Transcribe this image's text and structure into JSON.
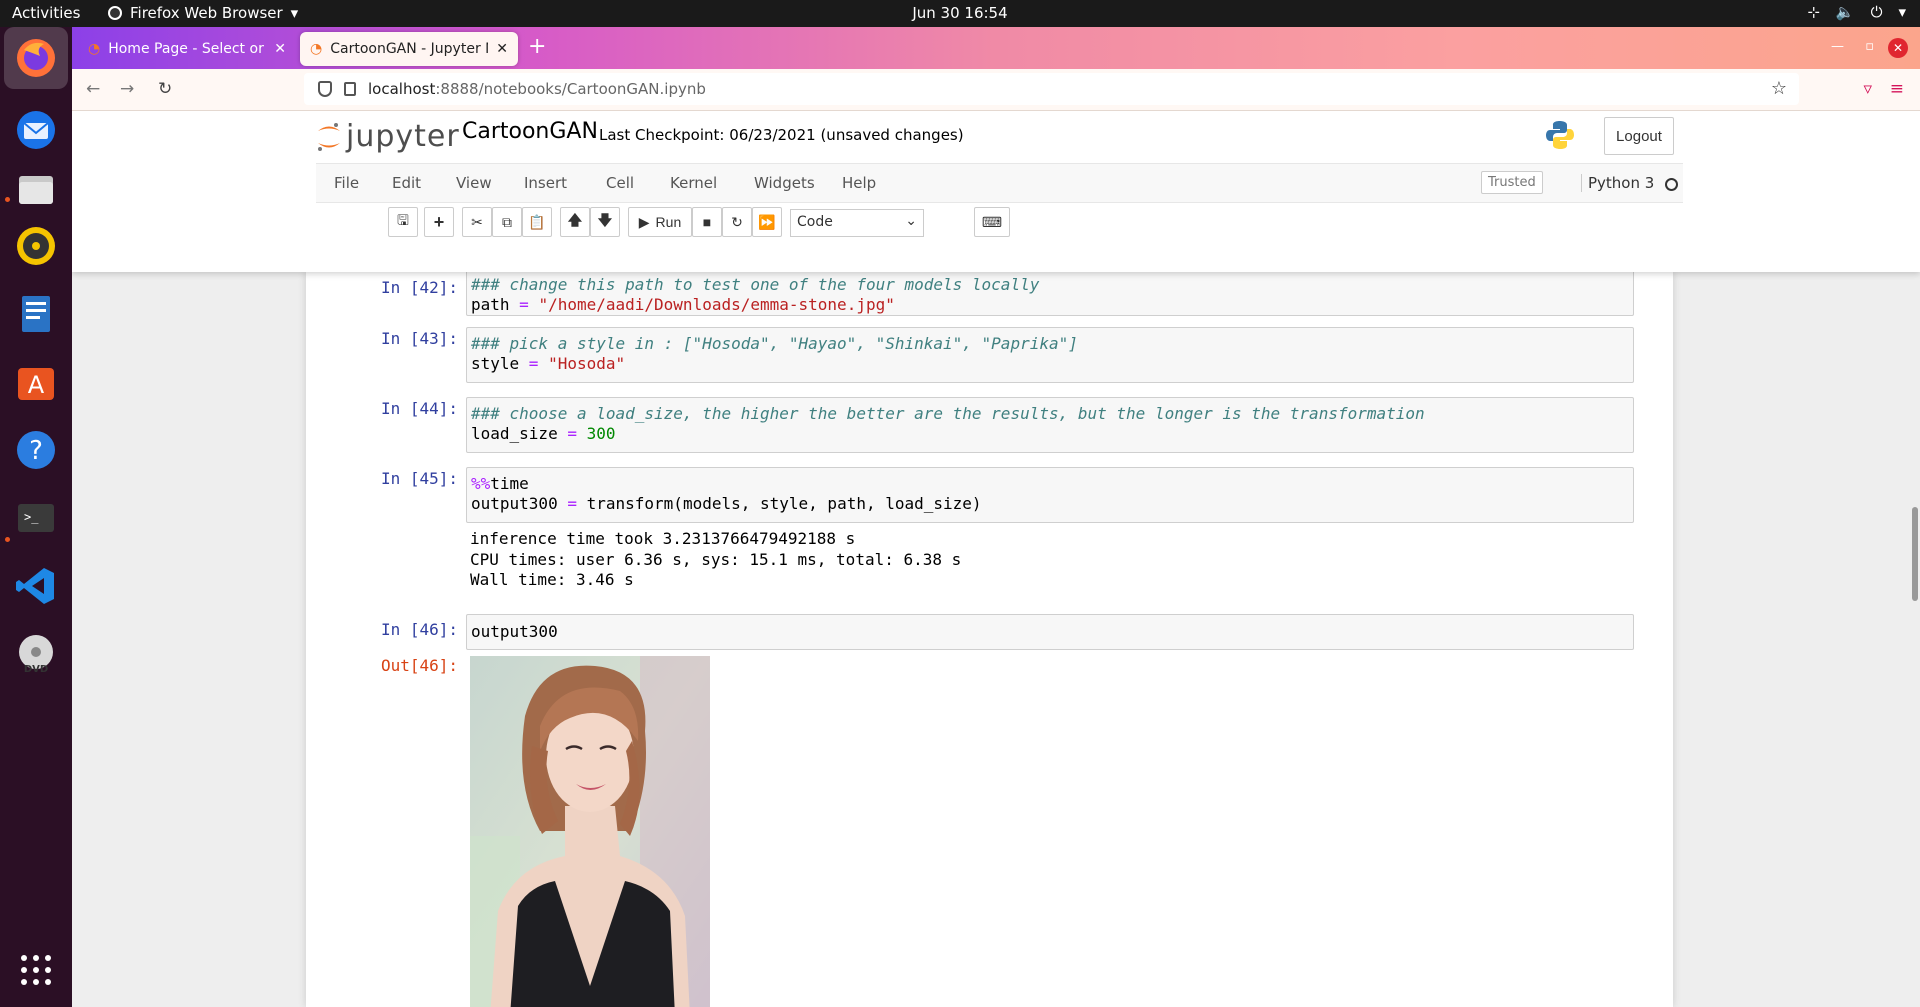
{
  "topbar": {
    "activities": "Activities",
    "app": "Firefox Web Browser",
    "clock": "Jun 30  16:54"
  },
  "dock": {
    "icons": [
      "firefox-icon",
      "thunderbird-icon",
      "files-icon",
      "rhythmbox-icon",
      "libreoffice-writer-icon",
      "software-center-icon",
      "help-icon",
      "terminal-icon",
      "vscode-icon",
      "dvd-icon",
      "app-grid-icon"
    ]
  },
  "browser": {
    "tabs": [
      {
        "title": "Home Page - Select or cre"
      },
      {
        "title": "CartoonGAN - Jupyter No"
      }
    ],
    "url_host": "localhost",
    "url_path": ":8888/notebooks/CartoonGAN.ipynb"
  },
  "jupyter": {
    "logo_text": "jupyter",
    "notebook_title": "CartoonGAN",
    "checkpoint": "Last Checkpoint: 06/23/2021   (unsaved changes)",
    "logout": "Logout",
    "menus": [
      "File",
      "Edit",
      "View",
      "Insert",
      "Cell",
      "Kernel",
      "Widgets",
      "Help"
    ],
    "trusted": "Trusted",
    "kernel": "Python 3",
    "run_label": "Run",
    "cell_type": "Code"
  },
  "cells": [
    {
      "prompt": "In [42]:",
      "comment": "### change this path to test one of the four models locally",
      "code_var": "path",
      "code_op": " = ",
      "code_val": "\"/home/aadi/Downloads/emma-stone.jpg\""
    },
    {
      "prompt": "In [43]:",
      "comment": "### pick a style in : [\"Hosoda\", \"Hayao\", \"Shinkai\", \"Paprika\"]",
      "code_var": "style",
      "code_op": " = ",
      "code_val": "\"Hosoda\""
    },
    {
      "prompt": "In [44]:",
      "comment": "### choose a load_size, the higher the better are the results, but the longer is the transformation",
      "code_var": "load_size",
      "code_op": " = ",
      "code_val": "300"
    },
    {
      "prompt": "In [45]:",
      "magic": "%%",
      "magic_word": "time",
      "line2_var": "output300",
      "line2_op": " = ",
      "line2_rest": "transform(models, style, path, load_size)",
      "output": [
        "inference time took 3.2313766479492188 s",
        "CPU times: user 6.36 s, sys: 15.1 ms, total: 6.38 s",
        "Wall time: 3.46 s"
      ]
    },
    {
      "prompt": "In [46]:",
      "code": "output300",
      "out_prompt": "Out[46]:"
    }
  ]
}
